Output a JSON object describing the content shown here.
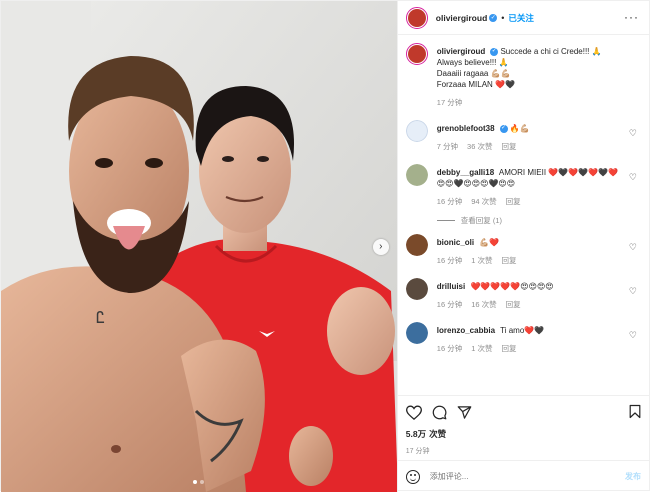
{
  "header": {
    "username": "oliviergiroud",
    "separator": "•",
    "follow_label": "已关注",
    "more_icon": "more-horizontal-icon"
  },
  "caption": {
    "username": "oliviergiroud",
    "lines": [
      "Succede a chi ci Crede!!! 🙏",
      "Always believe!!! 🙏",
      "Daaaiii ragaaa 💪🏼💪🏼",
      "Forzaaa MILAN ❤️🖤"
    ],
    "time": "17 分钟"
  },
  "comments": [
    {
      "username": "grenoblefoot38",
      "text": "🔥💪🏼",
      "time": "7 分钟",
      "likes": "36 次赞",
      "reply": "回复",
      "verified": true,
      "avatar_color": "#e6eef8"
    },
    {
      "username": "debby__galli18",
      "text": "AMORI MIEII ❤️🖤❤️🖤❤️🖤❤️ 😍😍🖤😍😍😍🖤😍😍",
      "time": "16 分钟",
      "likes": "94 次赞",
      "reply": "回复",
      "verified": false,
      "avatar_color": "#a4b08c",
      "view_replies": "查看回复 (1)"
    },
    {
      "username": "bionic_oli",
      "text": "💪🏼❤️",
      "time": "16 分钟",
      "likes": "1 次赞",
      "reply": "回复",
      "verified": false,
      "avatar_color": "#7a4a2a"
    },
    {
      "username": "drilluisi",
      "text": "❤️❤️❤️❤️❤️😍😍😍😍",
      "time": "16 分钟",
      "likes": "16 次赞",
      "reply": "回复",
      "verified": false,
      "avatar_color": "#5a4a3e"
    },
    {
      "username": "lorenzo_cabbia",
      "text": "Ti amo❤️🖤",
      "time": "16 分钟",
      "likes": "1 次赞",
      "reply": "回复",
      "verified": false,
      "avatar_color": "#3c6e9e"
    }
  ],
  "actions": {
    "like_icon": "heart-icon",
    "comment_icon": "comment-icon",
    "share_icon": "share-icon",
    "save_icon": "bookmark-icon"
  },
  "likes": {
    "count": "5.8万",
    "label": "次赞"
  },
  "posted_time": "17 分钟",
  "add_comment": {
    "placeholder": "添加评论...",
    "post_label": "发布"
  },
  "colors": {
    "accent": "#0095f6",
    "verified": "#3897f0",
    "muted": "#8e8e8e",
    "jersey": "#e3262a"
  }
}
